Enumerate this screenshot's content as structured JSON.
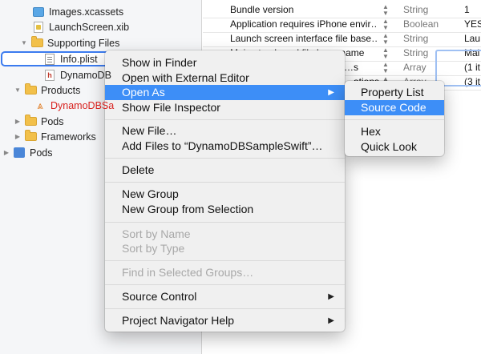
{
  "navigator": {
    "rows": [
      {
        "label": "Images.xcassets"
      },
      {
        "label": "LaunchScreen.xib"
      },
      {
        "label": "Supporting Files"
      },
      {
        "label": "Info.plist"
      },
      {
        "label": "DynamoDB"
      },
      {
        "label": "Products"
      },
      {
        "label": "DynamoDBSa"
      },
      {
        "label": "Pods"
      },
      {
        "label": "Frameworks"
      },
      {
        "label": "Pods"
      }
    ]
  },
  "plist": {
    "rows": [
      {
        "key": "Bundle version",
        "type": "String",
        "value": "1"
      },
      {
        "key": "Application requires iPhone envir…",
        "type": "Boolean",
        "value": "YES"
      },
      {
        "key": "Launch screen interface file base…",
        "type": "String",
        "value": "Lau"
      },
      {
        "key": "Main storyboard file base name",
        "type": "String",
        "value": "Mai"
      },
      {
        "key": "…s",
        "type": "Array",
        "value": "(1 it"
      },
      {
        "key": "…ations",
        "type": "Array",
        "value": "(3 it"
      }
    ]
  },
  "context_menu": {
    "show_in_finder": "Show in Finder",
    "open_external": "Open with External Editor",
    "open_as": "Open As",
    "show_inspector": "Show File Inspector",
    "new_file": "New File…",
    "add_files": "Add Files to “DynamoDBSampleSwift”…",
    "delete": "Delete",
    "new_group": "New Group",
    "new_group_selection": "New Group from Selection",
    "sort_by_name": "Sort by Name",
    "sort_by_type": "Sort by Type",
    "find_in_groups": "Find in Selected Groups…",
    "source_control": "Source Control",
    "help": "Project Navigator Help"
  },
  "submenu": {
    "property_list": "Property List",
    "source_code": "Source Code",
    "hex": "Hex",
    "quick_look": "Quick Look"
  },
  "colors": {
    "highlight": "#3d8ef7",
    "selection_border": "#3b7bef",
    "product_red": "#d8221f"
  }
}
